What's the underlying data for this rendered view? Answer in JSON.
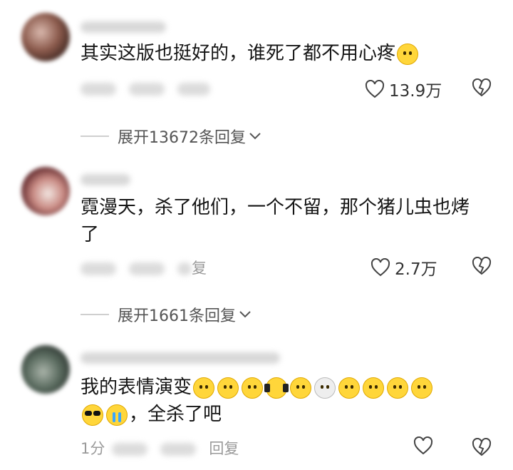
{
  "comments": [
    {
      "text": "其实这版也挺好的，谁死了都不用心疼",
      "likes": "13.9万",
      "expand_label": "展开13672条回复"
    },
    {
      "text": "霓漫天，杀了他们，一个不留，那个猪儿虫也烤了",
      "meta_reply": "复",
      "likes": "2.7万",
      "expand_label": "展开1661条回复"
    },
    {
      "text_main": "我的表情演变",
      "text_end": "，全杀了吧",
      "meta_time": "1分",
      "meta_reply": "回复",
      "emojis": [
        "smile-emoji",
        "smirk-emoji",
        "dizzy-emoji",
        "headphone-emoji",
        "shock-emoji",
        "scream-emoji",
        "awkward-emoji",
        "sweat-smile-emoji",
        "pleading-emoji",
        "pleading-hands-emoji",
        "sunglasses-emoji",
        "crying-emoji"
      ]
    }
  ],
  "colors": {
    "text": "#151515",
    "meta": "#9a9a9a",
    "emoji": "#ffd63a"
  }
}
